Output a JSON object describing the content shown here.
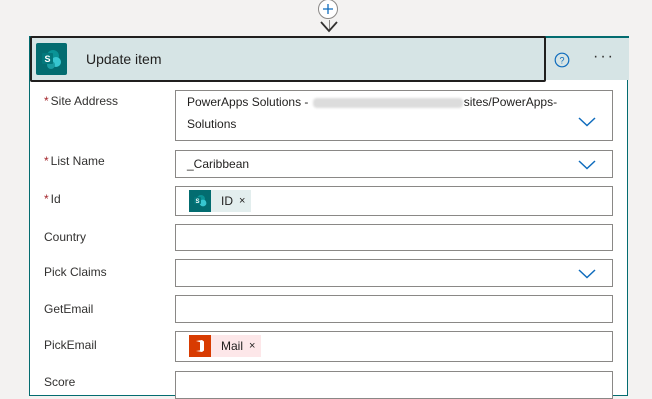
{
  "action": {
    "title": "Update item",
    "more_label": "···"
  },
  "fields": {
    "site_address": {
      "label": "Site Address",
      "required_mark": "*",
      "value_prefix": "PowerApps Solutions - ",
      "value_suffix": "sites/PowerApps-",
      "value_line2": "Solutions"
    },
    "list_name": {
      "label": "List Name",
      "required_mark": "*",
      "value": "_Caribbean"
    },
    "id": {
      "label": "Id",
      "required_mark": "*",
      "token": "ID",
      "token_remove": "×"
    },
    "country": {
      "label": "Country"
    },
    "pick_claims": {
      "label": "Pick Claims"
    },
    "get_email": {
      "label": "GetEmail"
    },
    "pick_email": {
      "label": "PickEmail",
      "token": "Mail",
      "token_remove": "×"
    },
    "score": {
      "label": "Score"
    }
  },
  "colors": {
    "sharepoint_teal": "#036c70",
    "header_bg": "#d6e4e5",
    "office_red": "#d83b01",
    "chevron_blue": "#0f6cbd",
    "required_red": "#a4262c"
  },
  "icons": [
    "plus-icon",
    "arrow-down-icon",
    "sharepoint-icon",
    "help-icon",
    "chevron-down-icon",
    "office-icon"
  ]
}
